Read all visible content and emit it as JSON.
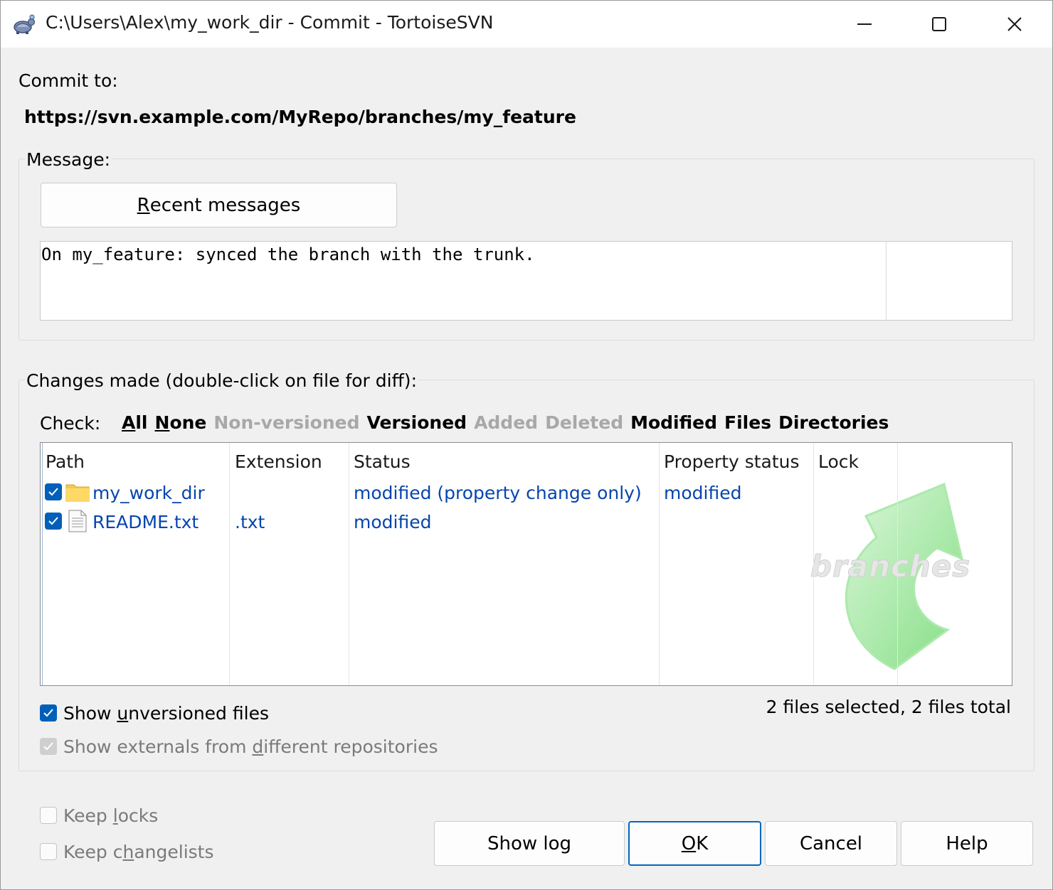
{
  "window": {
    "title": "C:\\Users\\Alex\\my_work_dir - Commit - TortoiseSVN",
    "controls": [
      "minimize-icon",
      "maximize-icon",
      "close-icon"
    ]
  },
  "commit_to": {
    "label": "Commit to:",
    "url": "https://svn.example.com/MyRepo/branches/my_feature"
  },
  "message_group": {
    "label": "Message:",
    "recent_button": {
      "prefix": "",
      "accel": "R",
      "rest": "ecent messages"
    },
    "text": "On my_feature: synced the branch with the trunk."
  },
  "changes_group": {
    "label": "Changes made (double-click on file for diff):",
    "check_label": "Check:",
    "filters": [
      {
        "accel": "A",
        "rest": "ll",
        "enabled": true
      },
      {
        "accel": "N",
        "rest": "one",
        "enabled": true
      },
      {
        "text": "Non-versioned",
        "enabled": false
      },
      {
        "text": "Versioned",
        "enabled": true
      },
      {
        "text": "Added",
        "enabled": false
      },
      {
        "text": "Deleted",
        "enabled": false
      },
      {
        "text": "Modified",
        "enabled": true
      },
      {
        "text": "Files",
        "enabled": true
      },
      {
        "text": "Directories",
        "enabled": true
      }
    ],
    "columns": [
      "Path",
      "Extension",
      "Status",
      "Property status",
      "Lock"
    ],
    "rows": [
      {
        "checked": true,
        "icon": "folder-icon",
        "path": "my_work_dir",
        "extension": "",
        "status": "modified (property change only)",
        "property_status": "modified",
        "lock": ""
      },
      {
        "checked": true,
        "icon": "text-file-icon",
        "path": "README.txt",
        "extension": ".txt",
        "status": "modified",
        "property_status": "",
        "lock": ""
      }
    ],
    "watermark_text": "branches",
    "show_unversioned": {
      "checked": true,
      "prefix": "Show ",
      "accel": "u",
      "rest": "nversioned files"
    },
    "show_externals": {
      "checked": true,
      "enabled": false,
      "prefix": "Show externals from ",
      "accel": "d",
      "rest": "ifferent repositories"
    },
    "selection_summary": "2 files selected, 2 files total"
  },
  "options": {
    "keep_locks": {
      "checked": false,
      "prefix": "Keep ",
      "accel": "l",
      "rest": "ocks"
    },
    "keep_changelists": {
      "checked": false,
      "prefix": "Keep c",
      "accel": "h",
      "rest": "angelists"
    }
  },
  "buttons": {
    "show_log": "Show log",
    "ok": {
      "accel": "O",
      "rest": "K"
    },
    "cancel": "Cancel",
    "help": "Help"
  },
  "colors": {
    "accent": "#005fb8",
    "link_blue": "#0645ad",
    "disabled_text": "#a8a8a8",
    "watermark_green": "#7fdc7f"
  }
}
